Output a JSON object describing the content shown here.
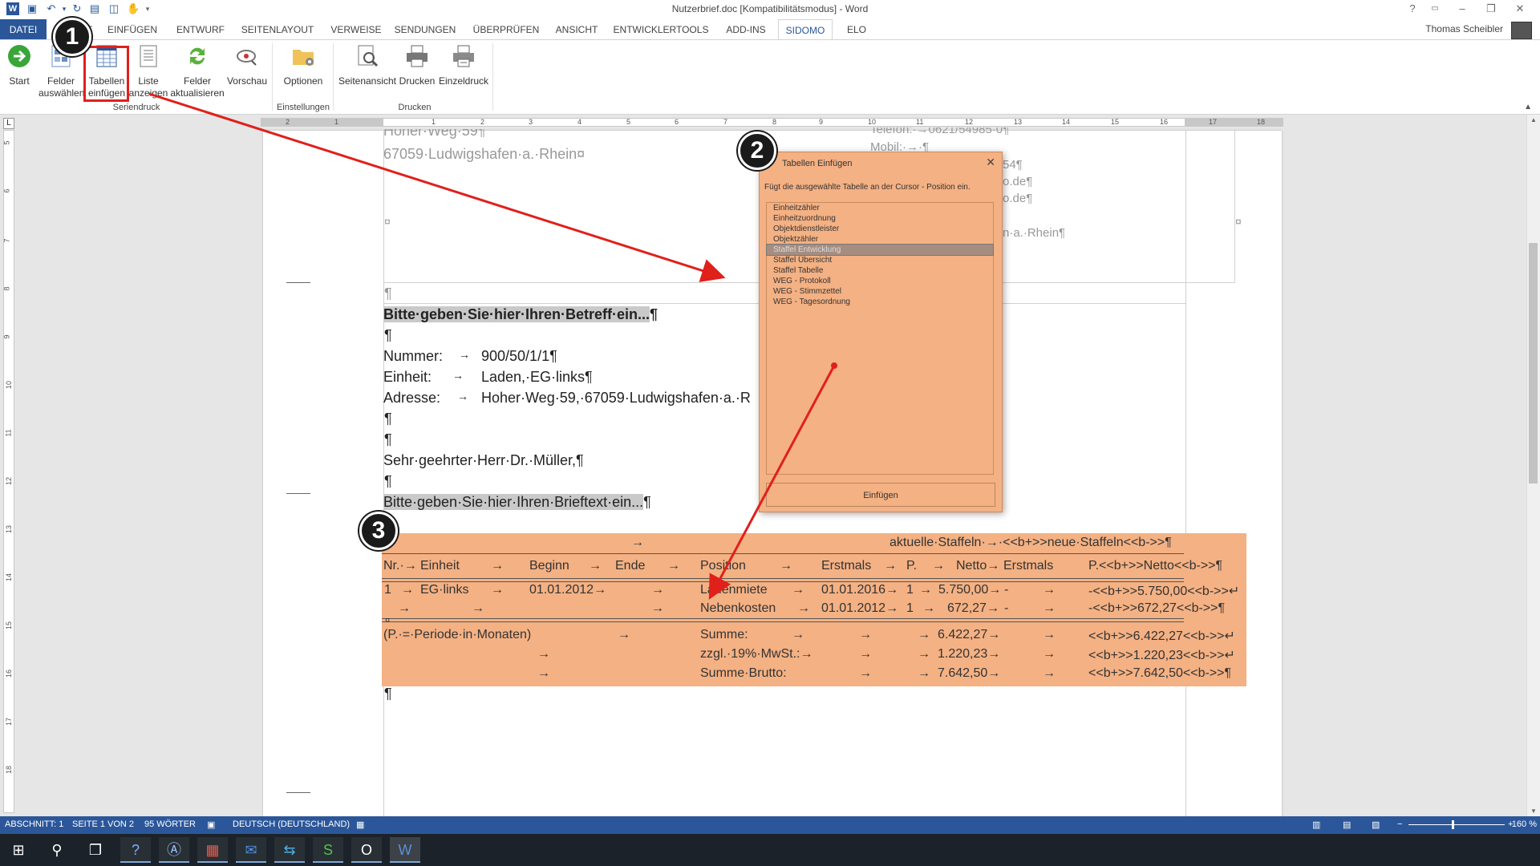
{
  "window": {
    "title": "Nutzerbrief.doc [Kompatibilitätsmodus] - Word",
    "user": "Thomas Scheibler",
    "help": "?",
    "controls": [
      "–",
      "❐",
      "✕"
    ]
  },
  "tabs": [
    "DATEI",
    "START",
    "EINFÜGEN",
    "ENTWURF",
    "SEITENLAYOUT",
    "VERWEISE",
    "SENDUNGEN",
    "ÜBERPRÜFEN",
    "ANSICHT",
    "ENTWICKLERTOOLS",
    "ADD-INS",
    "SIDOMO",
    "ELO"
  ],
  "active_tab": "SIDOMO",
  "ribbon": {
    "buttons": [
      {
        "label1": "Start",
        "label2": "",
        "icon": "go-arrow-icon"
      },
      {
        "label1": "Felder",
        "label2": "auswählen",
        "icon": "fields-grid-icon"
      },
      {
        "label1": "Tabellen",
        "label2": "einfügen",
        "icon": "table-icon"
      },
      {
        "label1": "Liste",
        "label2": "anzeigen",
        "icon": "list-icon"
      },
      {
        "label1": "Felder",
        "label2": "aktualisieren",
        "icon": "refresh-icon"
      },
      {
        "label1": "Vorschau",
        "label2": "",
        "icon": "preview-icon"
      },
      {
        "label1": "Optionen",
        "label2": "",
        "icon": "folder-gear-icon"
      },
      {
        "label1": "Seitenansicht",
        "label2": "",
        "icon": "page-magnify-icon"
      },
      {
        "label1": "Drucken",
        "label2": "",
        "icon": "printer-icon"
      },
      {
        "label1": "Einzeldruck",
        "label2": "",
        "icon": "single-print-icon"
      }
    ],
    "groups": [
      "Seriendruck",
      "Einstellungen",
      "Drucken"
    ]
  },
  "ruler": {
    "ticks": [
      "2",
      "1",
      "1",
      "2",
      "3",
      "4",
      "5",
      "6",
      "7",
      "8",
      "9",
      "10",
      "11",
      "12",
      "13",
      "14",
      "15",
      "16",
      "17",
      "18"
    ],
    "vticks": [
      "5",
      "6",
      "7",
      "8",
      "9",
      "10",
      "11",
      "12",
      "13",
      "14",
      "15",
      "16",
      "17",
      "18"
    ]
  },
  "document": {
    "addr1": "Hoher·Weg·59¶",
    "addr2": "67059·Ludwigshafen·a.·Rhein¤",
    "right1": "Telefon:·→0621/54985·0¶",
    "right2": "Mobil:·→·¶",
    "right3": "54¶",
    "right4": "o.de¶",
    "right5": "o.de¶",
    "right6": "n·a.·Rhein¶",
    "cellmark1": "¤",
    "cellmark2": "¤",
    "para0": "¶",
    "subject": "Bitte·geben·Sie·hier·Ihren·Betreff·ein...",
    "subject_mark": "¶",
    "para1": "¶",
    "nr_label": "Nummer:",
    "nr_value": "900/50/1/1¶",
    "unit_label": "Einheit:",
    "unit_value": "Laden,·EG·links¶",
    "addr_label": "Adresse:",
    "addr_value": "Hoher·Weg·59,·67059·Ludwigshafen·a.·R",
    "arrow": "→",
    "para2": "¶",
    "para3": "¶",
    "salutation": "Sehr·geehrter·Herr·Dr.·Müller,¶",
    "para4": "¶",
    "body": "Bitte·geben·Sie·hier·Ihren·Brieftext·ein...",
    "body_mark": "¶",
    "para_end": "¶"
  },
  "table": {
    "row0": {
      "arrow": "→",
      "right": "aktuelle·Staffeln·→·<<b+>>neue·Staffeln<<b->>¶"
    },
    "header": [
      "Nr.·→",
      "Einheit",
      "→",
      "Beginn",
      "→",
      "Ende",
      "→",
      "Position",
      "→",
      "Erstmals",
      "→",
      "P.",
      "→",
      "Netto→",
      "Erstmals",
      "→",
      "P.<<b+>>Netto<<b->>¶"
    ],
    "row1": [
      "1",
      "→",
      "EG·links",
      "→",
      "01.01.2012→",
      "→",
      "Ladenmiete",
      "→",
      "01.01.2016→",
      "1",
      "→",
      "5.750,00→",
      "-",
      "→",
      "-<<b+>>5.750,00<<b->>↵"
    ],
    "row2": [
      "→",
      "→",
      "→",
      "Nebenkosten",
      "→",
      "01.01.2012→",
      "1",
      "→",
      "672,27→",
      "-",
      "→",
      "-<<b+>>672,27<<b->>¶"
    ],
    "cellmark": "¤",
    "foot1": [
      "(P.·=·Periode·in·Monaten)",
      "→",
      "Summe:",
      "→",
      "→",
      "→",
      "6.422,27→",
      "→",
      "<<b+>>6.422,27<<b->>↵"
    ],
    "foot2": [
      "→",
      "zzgl.·19%·MwSt.:→",
      "→",
      "→",
      "1.220,23→",
      "→",
      "<<b+>>1.220,23<<b->>↵"
    ],
    "foot3": [
      "→",
      "Summe·Brutto:",
      "→",
      "→",
      "→",
      "7.642,50→",
      "→",
      "<<b+>>7.642,50<<b->>¶"
    ]
  },
  "dialog": {
    "title": "Tabellen Einfügen",
    "close": "✕",
    "description": "Fügt die ausgewählte Tabelle an der Cursor - Position ein.",
    "items": [
      "Einheitzähler",
      "Einheitzuordnung",
      "Objektdienstleister",
      "Objektzähler",
      "Staffel Entwicklung",
      "Staffel Übersicht",
      "Staffel Tabelle",
      "WEG - Protokoll",
      "WEG - Stimmzettel",
      "WEG - Tagesordnung"
    ],
    "selected_index": 4,
    "button": "Einfügen"
  },
  "badges": [
    "1",
    "2",
    "3"
  ],
  "status": {
    "section": "ABSCHNITT: 1",
    "page": "SEITE 1 VON 2",
    "words": "95 WÖRTER",
    "language": "DEUTSCH (DEUTSCHLAND)",
    "zoom": "160 %"
  },
  "colors": {
    "accent": "#2b579a",
    "dialog_bg": "#f4b183",
    "annotation_red": "#e0201b"
  }
}
